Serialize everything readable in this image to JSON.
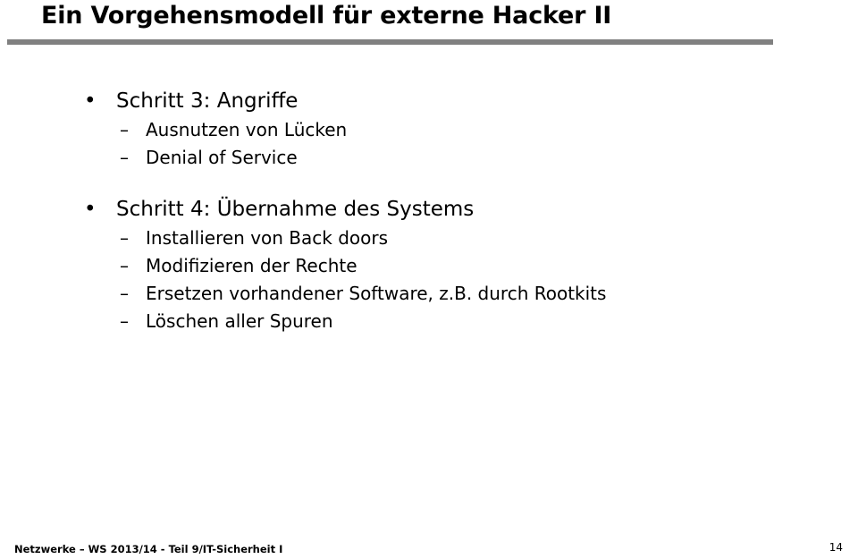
{
  "slide": {
    "title": "Ein Vorgehensmodell für externe Hacker II",
    "divider_color": "#808080",
    "background_color": "#ffffff",
    "text_color": "#000000"
  },
  "content": {
    "groups": [
      {
        "bullet_marker": "•",
        "heading": "Schritt 3: Angriffe",
        "subitems": [
          {
            "marker": "–",
            "text": "Ausnutzen von Lücken"
          },
          {
            "marker": "–",
            "text": "Denial of Service"
          }
        ]
      },
      {
        "bullet_marker": "•",
        "heading": "Schritt 4: Übernahme des Systems",
        "subitems": [
          {
            "marker": "–",
            "text": "Installieren von Back doors"
          },
          {
            "marker": "–",
            "text": "Modifizieren der Rechte"
          },
          {
            "marker": "–",
            "text": "Ersetzen vorhandener Software, z.B. durch Rootkits"
          },
          {
            "marker": "–",
            "text": "Löschen aller Spuren"
          }
        ]
      }
    ]
  },
  "footer": {
    "course_info": "Netzwerke – WS 2013/14 - Teil 9/IT-Sicherheit I",
    "page_number": "14"
  }
}
